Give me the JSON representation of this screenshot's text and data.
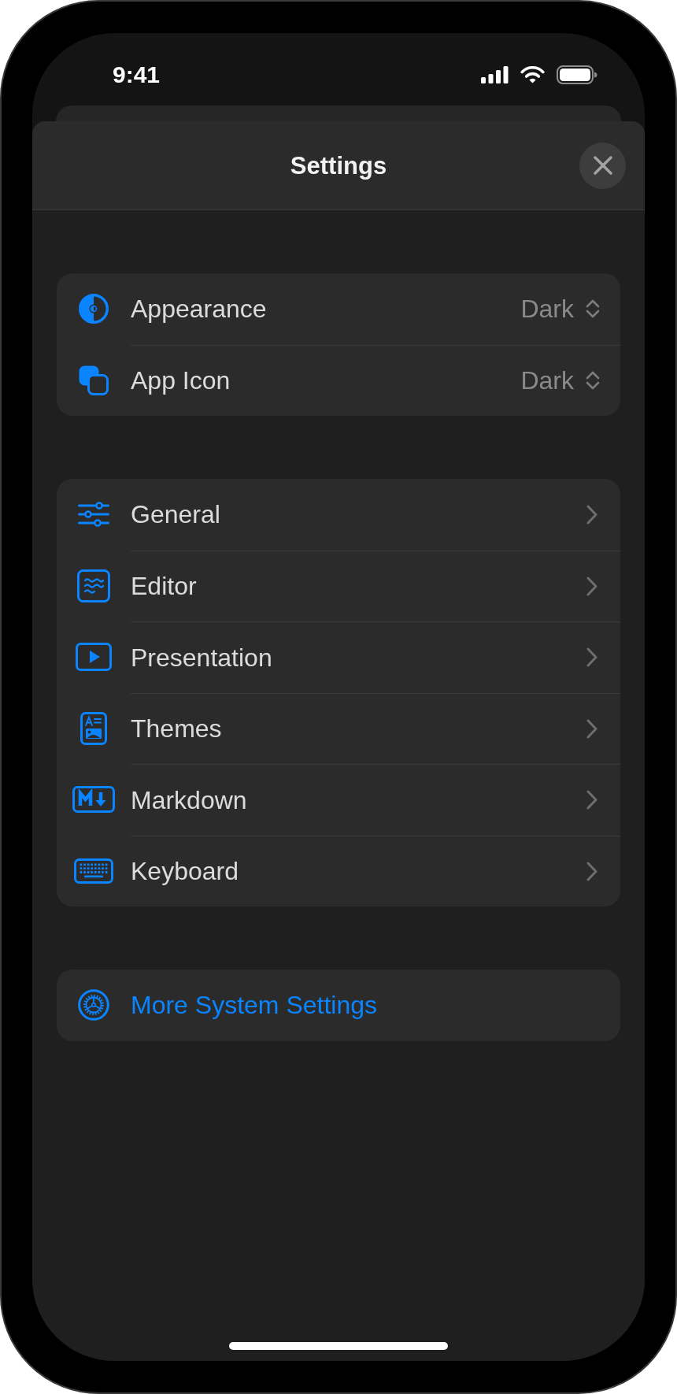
{
  "status_bar": {
    "time": "9:41"
  },
  "sheet": {
    "title": "Settings"
  },
  "groups": [
    {
      "rows": [
        {
          "kind": "picker",
          "label": "Appearance",
          "value": "Dark"
        },
        {
          "kind": "picker",
          "label": "App Icon",
          "value": "Dark"
        }
      ]
    },
    {
      "rows": [
        {
          "kind": "link",
          "label": "General"
        },
        {
          "kind": "link",
          "label": "Editor"
        },
        {
          "kind": "link",
          "label": "Presentation"
        },
        {
          "kind": "link",
          "label": "Themes"
        },
        {
          "kind": "link",
          "label": "Markdown"
        },
        {
          "kind": "link",
          "label": "Keyboard"
        }
      ]
    },
    {
      "rows": [
        {
          "kind": "action",
          "label": "More System Settings"
        }
      ]
    }
  ]
}
